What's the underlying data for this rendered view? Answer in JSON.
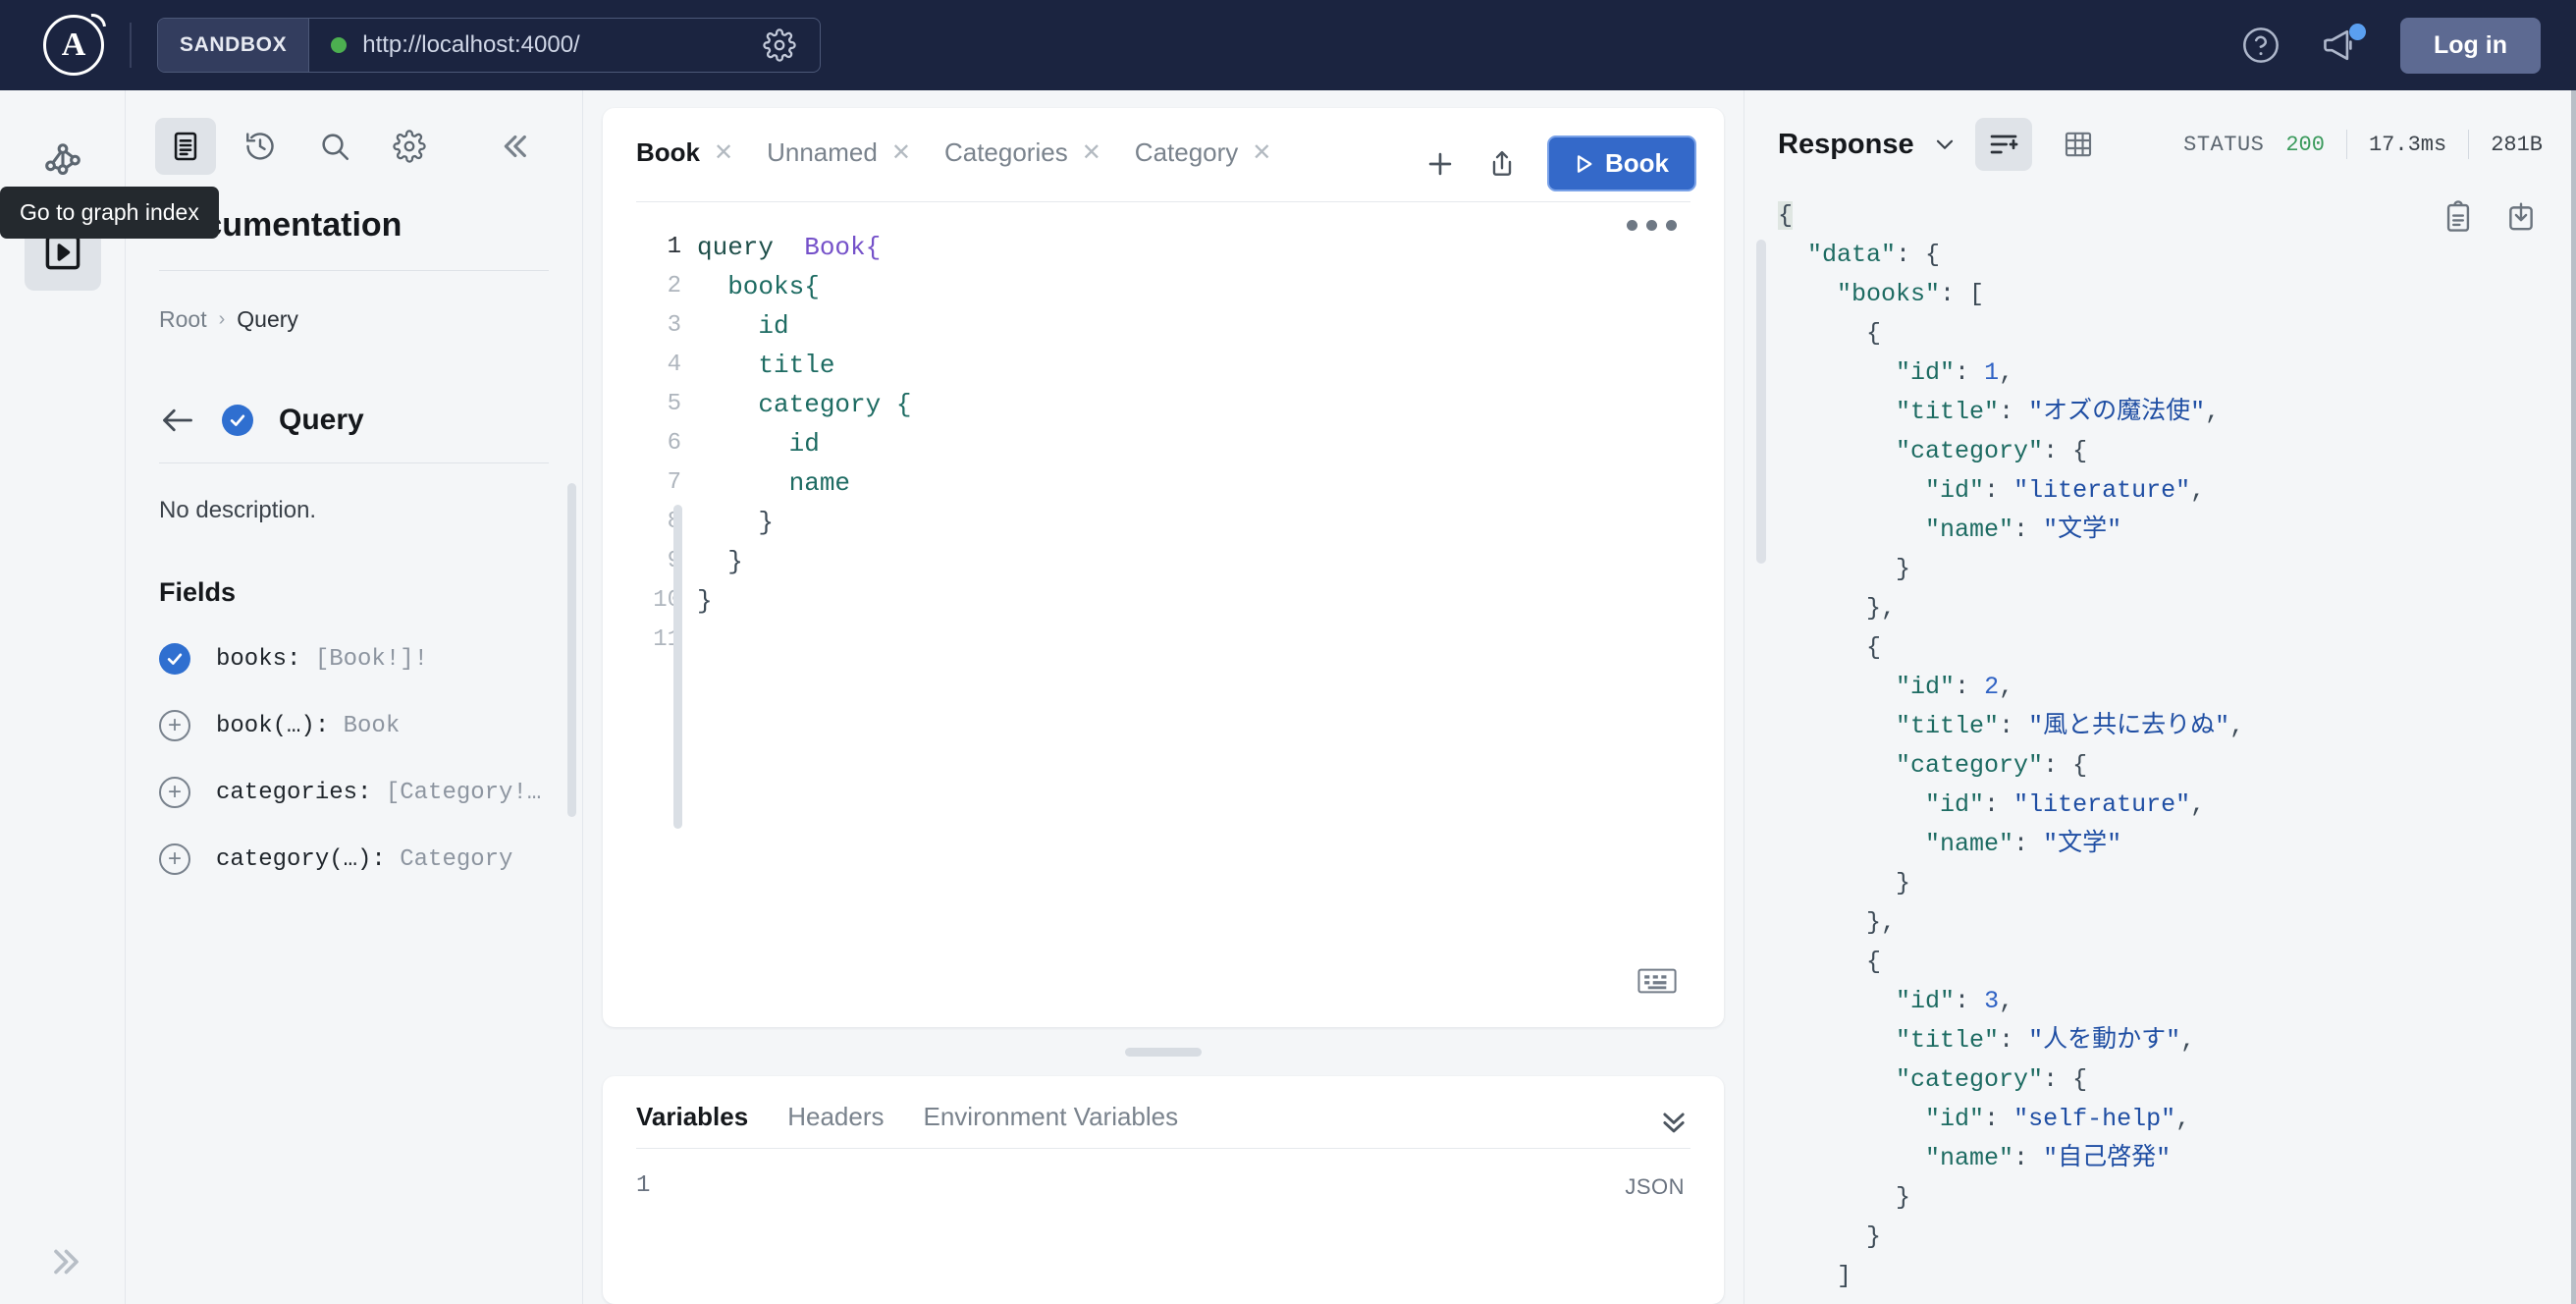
{
  "topbar": {
    "logo_letter": "A",
    "sandbox_chip": "SANDBOX",
    "url": "http://localhost:4000/",
    "gear_icon": "gear-icon",
    "help_icon": "help-circle-icon",
    "announcements_icon": "megaphone-icon",
    "login_label": "Log in"
  },
  "rail": {
    "tooltip": "Go to graph index",
    "graph_icon": "graph-nodes-icon",
    "explorer_icon": "play-square-icon",
    "expand_icon": "chevron-double-right-icon"
  },
  "docs": {
    "title": "Documentation",
    "toolbar": [
      {
        "name": "documentation-icon",
        "active": true
      },
      {
        "name": "history-icon",
        "active": false
      },
      {
        "name": "search-icon",
        "active": false
      },
      {
        "name": "settings-icon",
        "active": false
      }
    ],
    "collapse_icon": "chevron-double-left-icon",
    "breadcrumb": {
      "root": "Root",
      "separator": "›",
      "current": "Query"
    },
    "type_name": "Query",
    "description": "No description.",
    "fields_heading": "Fields",
    "fields": [
      {
        "name": "books",
        "signature": "books:",
        "type": " [Book!]!",
        "state": "selected"
      },
      {
        "name": "book",
        "signature": "book(…):",
        "type": " Book",
        "state": "add"
      },
      {
        "name": "categories",
        "signature": "categories:",
        "type": " [Category!…",
        "state": "add"
      },
      {
        "name": "category",
        "signature": "category(…):",
        "type": " Category",
        "state": "add"
      }
    ]
  },
  "operation": {
    "tabs": [
      {
        "label": "Book",
        "active": true
      },
      {
        "label": "Unnamed",
        "active": false
      },
      {
        "label": "Categories",
        "active": false
      },
      {
        "label": "Category",
        "active": false
      }
    ],
    "close_icon": "close-icon",
    "add_tab_icon": "plus-icon",
    "share_icon": "share-upload-icon",
    "run_button": {
      "label": "Book",
      "icon": "play-icon"
    },
    "menu_icon": "more-horizontal-icon",
    "keyboard_icon": "keyboard-icon",
    "editor_lines": [
      {
        "n": "1",
        "current": true,
        "tokens": [
          {
            "t": "query ",
            "c": "kw"
          },
          {
            "t": " Book{",
            "c": "opname"
          }
        ]
      },
      {
        "n": "2",
        "current": false,
        "tokens": [
          {
            "t": "  books{",
            "c": "field"
          }
        ]
      },
      {
        "n": "3",
        "current": false,
        "tokens": [
          {
            "t": "    id",
            "c": "field"
          }
        ]
      },
      {
        "n": "4",
        "current": false,
        "tokens": [
          {
            "t": "    title",
            "c": "field"
          }
        ]
      },
      {
        "n": "5",
        "current": false,
        "tokens": [
          {
            "t": "    category {",
            "c": "field"
          }
        ]
      },
      {
        "n": "6",
        "current": false,
        "tokens": [
          {
            "t": "      id",
            "c": "field"
          }
        ]
      },
      {
        "n": "7",
        "current": false,
        "tokens": [
          {
            "t": "      name",
            "c": "field"
          }
        ]
      },
      {
        "n": "8",
        "current": false,
        "tokens": [
          {
            "t": "    }",
            "c": "punct"
          }
        ]
      },
      {
        "n": "9",
        "current": false,
        "tokens": [
          {
            "t": "  }",
            "c": "punct"
          }
        ]
      },
      {
        "n": "10",
        "current": false,
        "tokens": [
          {
            "t": "}",
            "c": "punct"
          }
        ]
      },
      {
        "n": "11",
        "current": false,
        "tokens": [
          {
            "t": "",
            "c": "punct"
          }
        ]
      }
    ]
  },
  "variables_panel": {
    "tabs": [
      {
        "label": "Variables",
        "active": true
      },
      {
        "label": "Headers",
        "active": false
      },
      {
        "label": "Environment Variables",
        "active": false
      }
    ],
    "collapse_icon": "chevron-double-down-icon",
    "line_number": "1",
    "format_label": "JSON"
  },
  "response": {
    "title": "Response",
    "dropdown_icon": "chevron-down-icon",
    "view_json_icon": "json-view-icon",
    "view_table_icon": "table-view-icon",
    "copy_icon": "clipboard-copy-icon",
    "download_icon": "download-icon",
    "stats": {
      "status_label": "STATUS",
      "status_value": "200",
      "duration": "17.3ms",
      "size": "281B"
    },
    "json_lines": [
      {
        "indent": 0,
        "tokens": [
          {
            "t": "{",
            "c": "brace-hl"
          }
        ]
      },
      {
        "indent": 1,
        "tokens": [
          {
            "t": "\"data\"",
            "c": "key"
          },
          {
            "t": ": {",
            "c": "brace"
          }
        ]
      },
      {
        "indent": 2,
        "tokens": [
          {
            "t": "\"books\"",
            "c": "key"
          },
          {
            "t": ": [",
            "c": "brace"
          }
        ]
      },
      {
        "indent": 3,
        "tokens": [
          {
            "t": "{",
            "c": "brace"
          }
        ]
      },
      {
        "indent": 4,
        "tokens": [
          {
            "t": "\"id\"",
            "c": "key"
          },
          {
            "t": ": ",
            "c": "brace"
          },
          {
            "t": "1",
            "c": "num"
          },
          {
            "t": ",",
            "c": "brace"
          }
        ]
      },
      {
        "indent": 4,
        "tokens": [
          {
            "t": "\"title\"",
            "c": "key"
          },
          {
            "t": ": ",
            "c": "brace"
          },
          {
            "t": "\"オズの魔法使\"",
            "c": "str"
          },
          {
            "t": ",",
            "c": "brace"
          }
        ]
      },
      {
        "indent": 4,
        "tokens": [
          {
            "t": "\"category\"",
            "c": "key"
          },
          {
            "t": ": {",
            "c": "brace"
          }
        ]
      },
      {
        "indent": 5,
        "tokens": [
          {
            "t": "\"id\"",
            "c": "key"
          },
          {
            "t": ": ",
            "c": "brace"
          },
          {
            "t": "\"literature\"",
            "c": "str"
          },
          {
            "t": ",",
            "c": "brace"
          }
        ]
      },
      {
        "indent": 5,
        "tokens": [
          {
            "t": "\"name\"",
            "c": "key"
          },
          {
            "t": ": ",
            "c": "brace"
          },
          {
            "t": "\"文学\"",
            "c": "str"
          }
        ]
      },
      {
        "indent": 4,
        "tokens": [
          {
            "t": "}",
            "c": "brace"
          }
        ]
      },
      {
        "indent": 3,
        "tokens": [
          {
            "t": "},",
            "c": "brace"
          }
        ]
      },
      {
        "indent": 3,
        "tokens": [
          {
            "t": "{",
            "c": "brace"
          }
        ]
      },
      {
        "indent": 4,
        "tokens": [
          {
            "t": "\"id\"",
            "c": "key"
          },
          {
            "t": ": ",
            "c": "brace"
          },
          {
            "t": "2",
            "c": "num"
          },
          {
            "t": ",",
            "c": "brace"
          }
        ]
      },
      {
        "indent": 4,
        "tokens": [
          {
            "t": "\"title\"",
            "c": "key"
          },
          {
            "t": ": ",
            "c": "brace"
          },
          {
            "t": "\"風と共に去りぬ\"",
            "c": "str"
          },
          {
            "t": ",",
            "c": "brace"
          }
        ]
      },
      {
        "indent": 4,
        "tokens": [
          {
            "t": "\"category\"",
            "c": "key"
          },
          {
            "t": ": {",
            "c": "brace"
          }
        ]
      },
      {
        "indent": 5,
        "tokens": [
          {
            "t": "\"id\"",
            "c": "key"
          },
          {
            "t": ": ",
            "c": "brace"
          },
          {
            "t": "\"literature\"",
            "c": "str"
          },
          {
            "t": ",",
            "c": "brace"
          }
        ]
      },
      {
        "indent": 5,
        "tokens": [
          {
            "t": "\"name\"",
            "c": "key"
          },
          {
            "t": ": ",
            "c": "brace"
          },
          {
            "t": "\"文学\"",
            "c": "str"
          }
        ]
      },
      {
        "indent": 4,
        "tokens": [
          {
            "t": "}",
            "c": "brace"
          }
        ]
      },
      {
        "indent": 3,
        "tokens": [
          {
            "t": "},",
            "c": "brace"
          }
        ]
      },
      {
        "indent": 3,
        "tokens": [
          {
            "t": "{",
            "c": "brace"
          }
        ]
      },
      {
        "indent": 4,
        "tokens": [
          {
            "t": "\"id\"",
            "c": "key"
          },
          {
            "t": ": ",
            "c": "brace"
          },
          {
            "t": "3",
            "c": "num"
          },
          {
            "t": ",",
            "c": "brace"
          }
        ]
      },
      {
        "indent": 4,
        "tokens": [
          {
            "t": "\"title\"",
            "c": "key"
          },
          {
            "t": ": ",
            "c": "brace"
          },
          {
            "t": "\"人を動かす\"",
            "c": "str"
          },
          {
            "t": ",",
            "c": "brace"
          }
        ]
      },
      {
        "indent": 4,
        "tokens": [
          {
            "t": "\"category\"",
            "c": "key"
          },
          {
            "t": ": {",
            "c": "brace"
          }
        ]
      },
      {
        "indent": 5,
        "tokens": [
          {
            "t": "\"id\"",
            "c": "key"
          },
          {
            "t": ": ",
            "c": "brace"
          },
          {
            "t": "\"self-help\"",
            "c": "str"
          },
          {
            "t": ",",
            "c": "brace"
          }
        ]
      },
      {
        "indent": 5,
        "tokens": [
          {
            "t": "\"name\"",
            "c": "key"
          },
          {
            "t": ": ",
            "c": "brace"
          },
          {
            "t": "\"自己啓発\"",
            "c": "str"
          }
        ]
      },
      {
        "indent": 4,
        "tokens": [
          {
            "t": "}",
            "c": "brace"
          }
        ]
      },
      {
        "indent": 3,
        "tokens": [
          {
            "t": "}",
            "c": "brace"
          }
        ]
      },
      {
        "indent": 2,
        "tokens": [
          {
            "t": "]",
            "c": "brace"
          }
        ]
      }
    ]
  },
  "colors": {
    "topbar_bg": "#1b2440",
    "accent_blue": "#3469c9",
    "status_green": "#3a9a5c",
    "panel_bg": "#f4f6f8"
  }
}
